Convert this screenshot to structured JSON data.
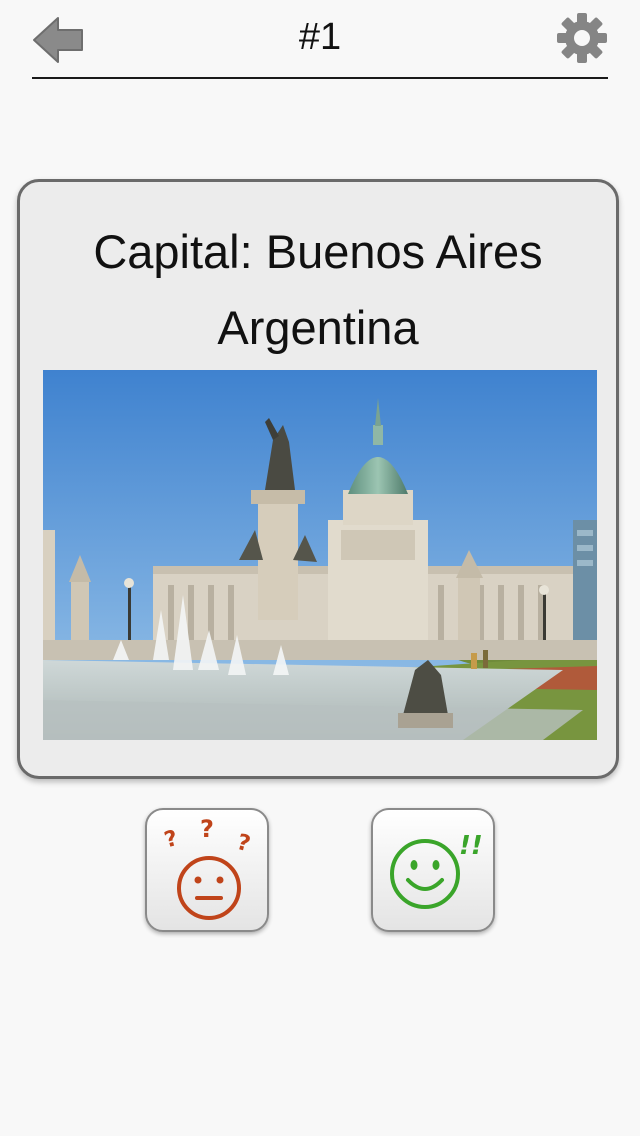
{
  "header": {
    "title": "#1",
    "back_icon": "arrow-left-icon",
    "settings_icon": "gear-icon"
  },
  "card": {
    "question": "Capital: Buenos Aires",
    "answer": "Argentina",
    "photo": "photo of the Congress Palace in Buenos Aires with fountain and monument"
  },
  "actions": {
    "unknown_icon": "puzzled-face-icon",
    "known_icon": "smiling-face-icon"
  },
  "colors": {
    "unknown": "#c0441a",
    "known": "#3aa52a",
    "icon_gray": "#808080"
  }
}
